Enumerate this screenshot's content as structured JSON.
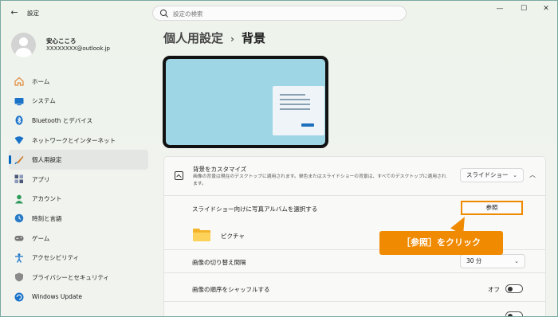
{
  "window": {
    "title": "設定",
    "back_icon": "back-arrow-icon",
    "controls": {
      "minimize": "—",
      "maximize": "☐",
      "close": "✕"
    }
  },
  "search": {
    "placeholder": "設定の検索"
  },
  "profile": {
    "name": "安心こころ",
    "email": "XXXXXXXX@outlook.jp"
  },
  "sidebar": {
    "items": [
      {
        "label": "ホーム",
        "icon": "home-icon",
        "color": "#e08a3c"
      },
      {
        "label": "システム",
        "icon": "system-icon",
        "color": "#1a73c9"
      },
      {
        "label": "Bluetooth とデバイス",
        "icon": "bluetooth-icon",
        "color": "#1a73c9"
      },
      {
        "label": "ネットワークとインターネット",
        "icon": "network-icon",
        "color": "#1a73c9"
      },
      {
        "label": "個人用設定",
        "icon": "personalization-icon",
        "color": "#d07a2a",
        "active": true
      },
      {
        "label": "アプリ",
        "icon": "apps-icon",
        "color": "#4a5a78"
      },
      {
        "label": "アカウント",
        "icon": "account-icon",
        "color": "#2e9b5b"
      },
      {
        "label": "時刻と言語",
        "icon": "time-language-icon",
        "color": "#2a7cc8"
      },
      {
        "label": "ゲーム",
        "icon": "gaming-icon",
        "color": "#777777"
      },
      {
        "label": "アクセシビリティ",
        "icon": "accessibility-icon",
        "color": "#1a73c9"
      },
      {
        "label": "プライバシーとセキュリティ",
        "icon": "shield-icon",
        "color": "#777777"
      },
      {
        "label": "Windows Update",
        "icon": "windows-update-icon",
        "color": "#1a73c9"
      }
    ]
  },
  "breadcrumb": {
    "parent": "個人用設定",
    "separator": "›",
    "current": "背景"
  },
  "customize": {
    "title": "背景をカスタマイズ",
    "description": "画像の背景は現在のデスクトップに適用されます。単色またはスライドショーの背景は、すべてのデスクトップに適用されます。",
    "dropdown_value": "スライドショー"
  },
  "album": {
    "label": "スライドショー向けに写真アルバムを選択する",
    "browse_label": "参照",
    "folder_name": "ピクチャ"
  },
  "interval": {
    "label": "画像の切り替え間隔",
    "value": "30 分"
  },
  "shuffle": {
    "label": "画像の順序をシャッフルする",
    "state_label": "オフ"
  },
  "callout": {
    "text": "［参照］をクリック"
  },
  "accent_color": "#0067c0",
  "highlight_color": "#f08a00"
}
